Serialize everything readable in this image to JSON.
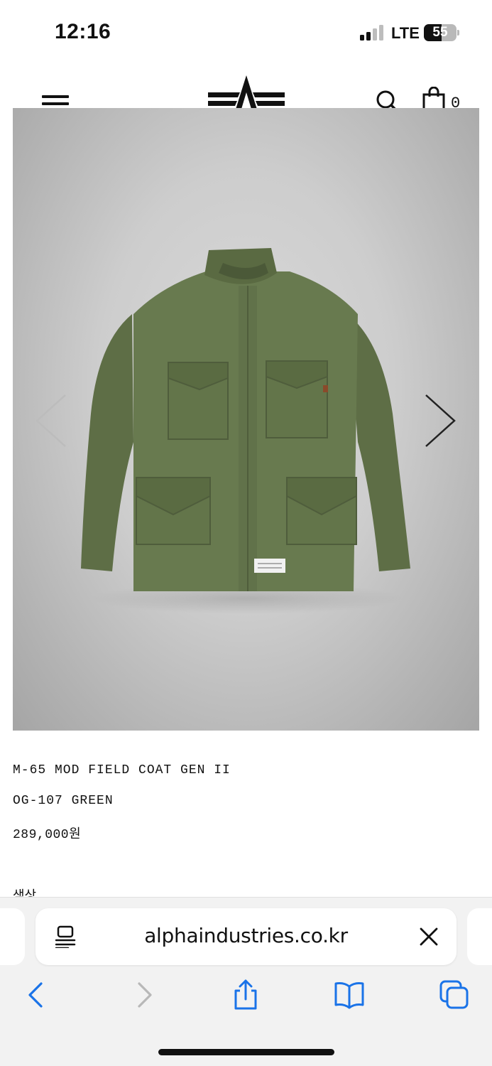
{
  "status_bar": {
    "time": "12:16",
    "network": "LTE",
    "battery_level": "55",
    "battery_fraction": 0.55,
    "signal_bars_active": 2
  },
  "header": {
    "menu_icon": "hamburger-menu-icon",
    "logo": "alpha-industries-logo",
    "search_icon": "search-icon",
    "cart_icon": "shopping-bag-icon",
    "cart_count": "0"
  },
  "product": {
    "image": "olive-green-field-coat-photo",
    "name": "M-65 MOD FIELD COAT GEN II",
    "color": "OG-107 GREEN",
    "price": "289,000원",
    "color_label": "색상",
    "prev_icon": "chevron-left-icon",
    "next_icon": "chevron-right-icon"
  },
  "browser": {
    "url": "alphaindustries.co.kr",
    "reader_icon": "page-menu-icon",
    "clear_icon": "close-icon",
    "toolbar": {
      "back_icon": "chevron-left-icon",
      "forward_icon": "chevron-right-icon",
      "share_icon": "share-icon",
      "bookmarks_icon": "book-icon",
      "tabs_icon": "tabs-icon"
    },
    "accent_color": "#1a73e8"
  }
}
